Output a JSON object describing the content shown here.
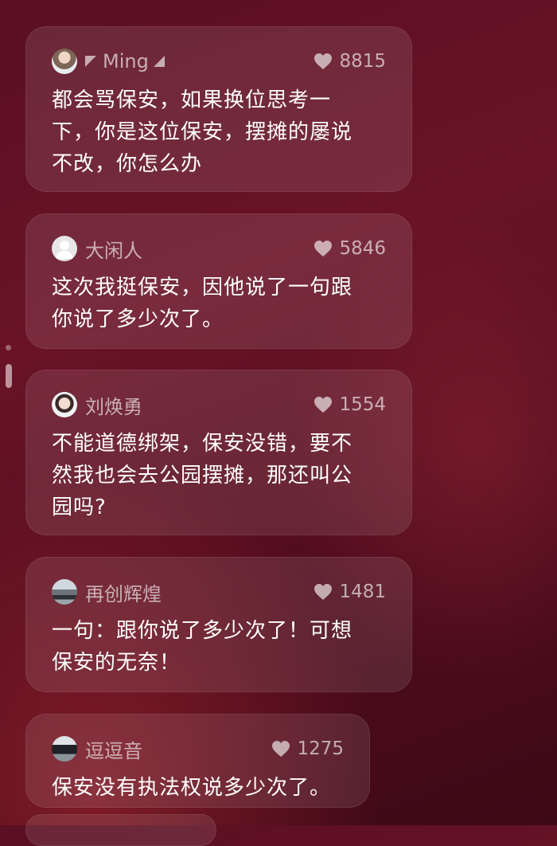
{
  "comments": [
    {
      "user": "Ming",
      "likes": "8815",
      "text": "都会骂保安，如果换位思考一\n下，你是这位保安，摆摊的屡说\n不改，你怎么办",
      "avatar": "photo-avatar-person",
      "decorated_name": true
    },
    {
      "user": "大闲人",
      "likes": "5846",
      "text": "这次我挺保安，因他说了一句跟\n你说了多少次了。",
      "avatar": "default-user-avatar"
    },
    {
      "user": "刘焕勇",
      "likes": "1554",
      "text": "不能道德绑架，保安没错，要不\n然我也会去公园摆摊，那还叫公\n园吗?",
      "avatar": "photo-avatar-portrait"
    },
    {
      "user": "再创辉煌",
      "likes": "1481",
      "text": "一句：跟你说了多少次了！可想\n保安的无奈！",
      "avatar": "photo-avatar-car"
    },
    {
      "user": "逗逗音",
      "likes": "1275",
      "text": "保安没有执法权说多少次了。",
      "avatar": "photo-avatar-car-dark"
    }
  ],
  "icons": {
    "like": "heart-icon"
  },
  "colors": {
    "background": "#5a0f22",
    "card": "rgba(255,255,255,0.10)",
    "text": "#ffffff",
    "meta": "rgba(255,255,255,0.62)"
  }
}
